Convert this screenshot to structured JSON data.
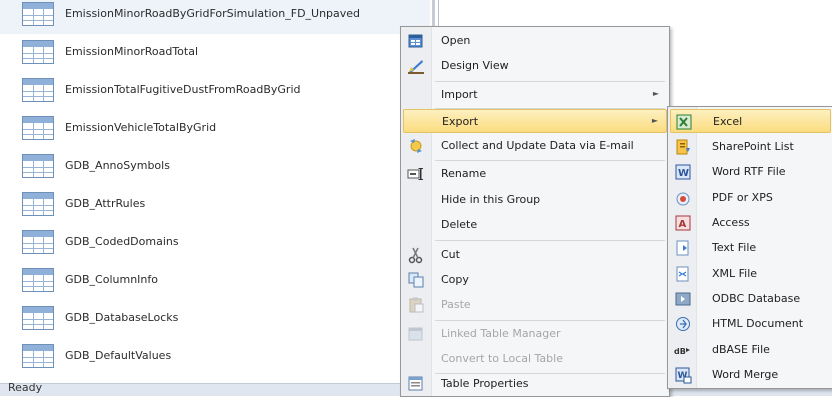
{
  "nav": {
    "items": [
      {
        "label": "EmissionMinorRoadByGridForSimulation_FD_Unpaved"
      },
      {
        "label": "EmissionMinorRoadTotal"
      },
      {
        "label": "EmissionTotalFugitiveDustFromRoadByGrid"
      },
      {
        "label": "EmissionVehicleTotalByGrid"
      },
      {
        "label": "GDB_AnnoSymbols"
      },
      {
        "label": "GDB_AttrRules"
      },
      {
        "label": "GDB_CodedDomains"
      },
      {
        "label": "GDB_ColumnInfo"
      },
      {
        "label": "GDB_DatabaseLocks"
      },
      {
        "label": "GDB_DefaultValues"
      }
    ]
  },
  "status": {
    "text": "Ready"
  },
  "context_menu": {
    "open": "Open",
    "design_view": "Design View",
    "import": "Import",
    "export": "Export",
    "collect": "Collect and Update Data via E-mail",
    "rename": "Rename",
    "hide": "Hide in this Group",
    "delete": "Delete",
    "cut": "Cut",
    "copy": "Copy",
    "paste": "Paste",
    "linked_table_manager": "Linked Table Manager",
    "convert_local": "Convert to Local Table",
    "table_properties": "Table Properties"
  },
  "export_menu": {
    "excel": "Excel",
    "sharepoint": "SharePoint List",
    "word_rtf": "Word RTF File",
    "pdf_xps": "PDF or XPS",
    "access": "Access",
    "text_file": "Text File",
    "xml_file": "XML File",
    "odbc": "ODBC Database",
    "html": "HTML Document",
    "dbase": "dBASE File",
    "word_merge": "Word Merge"
  },
  "colors": {
    "highlight": "#fbdc7f",
    "menu_bg": "#f5f6f7",
    "table_icon": "#8fb0d8"
  }
}
